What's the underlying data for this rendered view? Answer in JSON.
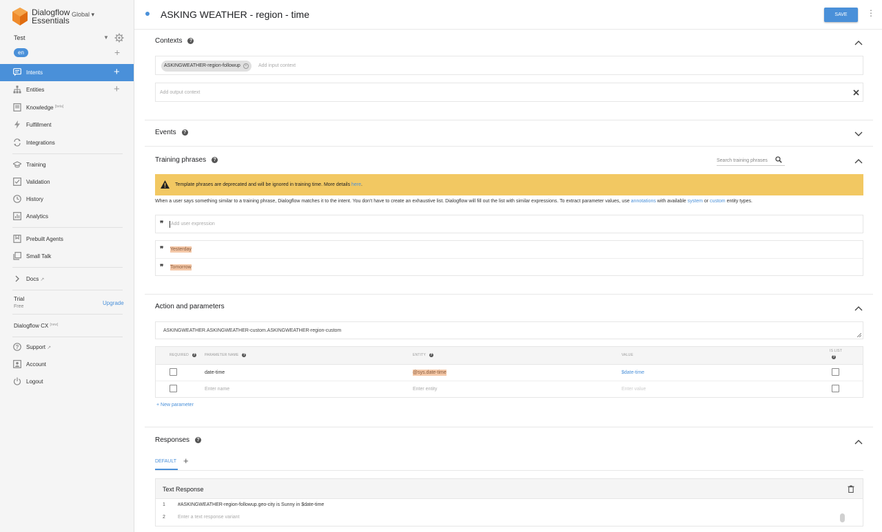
{
  "sidebar": {
    "brand_line1": "Dialogflow",
    "brand_line2": "Essentials",
    "region": "Global ▾",
    "agent": "Test",
    "language": "en",
    "nav": {
      "intents": "Intents",
      "entities": "Entities",
      "knowledge": "Knowledge",
      "knowledge_badge": "[beta]",
      "fulfillment": "Fulfillment",
      "integrations": "Integrations",
      "training": "Training",
      "validation": "Validation",
      "history": "History",
      "analytics": "Analytics",
      "prebuilt": "Prebuilt Agents",
      "smalltalk": "Small Talk",
      "docs": "Docs"
    },
    "trial_label": "Trial",
    "trial_sub": "Free",
    "upgrade": "Upgrade",
    "cx": "Dialogflow CX",
    "cx_badge": "[new]",
    "support": "Support",
    "account": "Account",
    "logout": "Logout"
  },
  "header": {
    "title": "ASKING WEATHER - region - time",
    "save": "SAVE"
  },
  "contexts": {
    "title": "Contexts",
    "input_chip": "ASKINGWEATHER-region-followup",
    "input_placeholder": "Add input context",
    "output_placeholder": "Add output context"
  },
  "events": {
    "title": "Events"
  },
  "training": {
    "title": "Training phrases",
    "search_placeholder": "Search training phrases",
    "warning": "Template phrases are deprecated and will be ignored in training time. More details ",
    "warning_link": "here",
    "desc_1": "When a user says something similar to a training phrase, Dialogflow matches it to the intent. You don't have to create an exhaustive list. Dialogflow will fill out the list with similar expressions. To extract parameter values, use ",
    "desc_annotations": "annotations",
    "desc_2": " with available ",
    "desc_system": "system",
    "desc_3": " or ",
    "desc_custom": "custom",
    "desc_4": " entity types.",
    "add_placeholder": "Add user expression",
    "phrases": [
      "Yesterday",
      "Tomorrow"
    ]
  },
  "action": {
    "title": "Action and parameters",
    "action_value": "ASKINGWEATHER.ASKINGWEATHER-custom.ASKINGWEATHER-region-custom",
    "headers": {
      "required": "REQUIRED",
      "param": "PARAMETER NAME",
      "entity": "ENTITY",
      "value": "VALUE",
      "islist": "IS LIST"
    },
    "row": {
      "name": "date-time",
      "entity": "@sys.date-time",
      "value": "$date-time"
    },
    "new_row": {
      "name": "Enter name",
      "entity": "Enter entity",
      "value": "Enter value"
    },
    "new_param": "New parameter"
  },
  "responses": {
    "title": "Responses",
    "tab": "DEFAULT",
    "card_title": "Text Response",
    "line1_num": "1",
    "line1": "#ASKINGWEATHER-region-followup.geo-city is Sunny in $date-time",
    "line2_num": "2",
    "line2_placeholder": "Enter a text response variant"
  },
  "colors": {
    "accent": "#4a90d9",
    "warning": "#f2c862",
    "highlight": "#f4c8a8",
    "logo": "#ef8b2c"
  }
}
